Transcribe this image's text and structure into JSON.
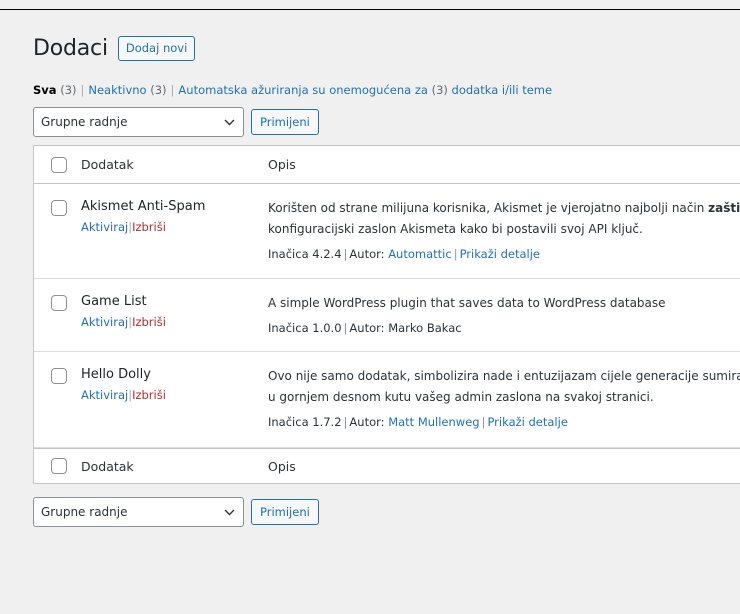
{
  "header": {
    "title": "Dodaci",
    "add_new_label": "Dodaj novi"
  },
  "filters": {
    "all_label": "Sva",
    "all_count": "(3)",
    "inactive_label": "Neaktivno",
    "inactive_count": "(3)",
    "autoupdate_label": "Automatska ažuriranja su onemogućena za",
    "autoupdate_count": "(3)",
    "autoupdate_suffix": "dodatka i/ili teme",
    "separator": "|"
  },
  "bulk": {
    "selected": "Grupne radnje",
    "apply_label": "Primijeni"
  },
  "table": {
    "col_plugin": "Dodatak",
    "col_desc": "Opis",
    "rows": [
      {
        "name": "Akismet Anti-Spam",
        "activate": "Aktiviraj",
        "delete": "Izbriši",
        "desc_line1": "Korišten od strane milijuna korisnika, Akismet je vjerojatno najbolji način",
        "desc_bold": "zaštit",
        "desc_line2": "konfiguracijski zaslon Akismeta kako bi postavili svoj API ključ.",
        "version": "Inačica 4.2.4",
        "author_prefix": "Autor:",
        "author": "Automattic",
        "details": "Prikaži detalje"
      },
      {
        "name": "Game List",
        "activate": "Aktiviraj",
        "delete": "Izbriši",
        "desc_line1": "A simple WordPress plugin that saves data to WordPress database",
        "version": "Inačica 1.0.0",
        "author_prefix": "Autor:",
        "author": "Marko Bakac"
      },
      {
        "name": "Hello Dolly",
        "activate": "Aktiviraj",
        "delete": "Izbriši",
        "desc_line1": "Ovo nije samo dodatak, simbolizira nade i entuzijazam cijele generacije sumirar",
        "desc_line2": "u gornjem desnom kutu vašeg admin zaslona na svakoj stranici.",
        "version": "Inačica 1.7.2",
        "author_prefix": "Autor:",
        "author": "Matt Mullenweg",
        "details": "Prikaži detalje"
      }
    ]
  },
  "icons": {
    "select_arrow": "chevron-down-icon"
  },
  "colors": {
    "link": "#2271b1",
    "delete": "#b32d2e",
    "background": "#f0f0f1"
  }
}
